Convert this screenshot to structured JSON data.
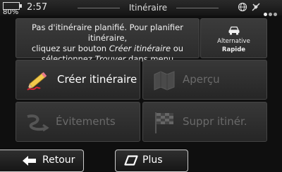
{
  "status": {
    "battery_percent": "80%",
    "time": "2:57",
    "title": "Itinéraire",
    "icons": [
      "battery-icon",
      "globe-icon",
      "satellite-icon",
      "page-dots-icon"
    ]
  },
  "info": {
    "line1": "Pas d'itinéraire planifié. Pour planifier itinéraire,",
    "line2a": "cliquez sur bouton ",
    "line2b": "Créer itinéraire",
    "line2c": " ou",
    "line3a": "sélectionnez ",
    "line3b": "Trouver",
    "line3c": " dans menu Navigation."
  },
  "alternative": {
    "label": "Alternative",
    "value": "Rapide",
    "icon": "car-icon"
  },
  "tiles": [
    {
      "label": "Créer itinéraire",
      "icon": "pencil-icon",
      "enabled": true
    },
    {
      "label": "Aperçu",
      "icon": "map-icon",
      "enabled": false
    },
    {
      "label": "Évitements",
      "icon": "route-avoid-icon",
      "enabled": false
    },
    {
      "label": "Suppr itinér.",
      "icon": "checkered-flag-icon",
      "enabled": false
    }
  ],
  "bottom": {
    "back_label": "Retour",
    "more_label": "Plus"
  },
  "colors": {
    "background": "#0f0f0f",
    "tile": "#2c2c2c",
    "text": "#ffffff",
    "disabled_text": "#6a6a6a"
  }
}
